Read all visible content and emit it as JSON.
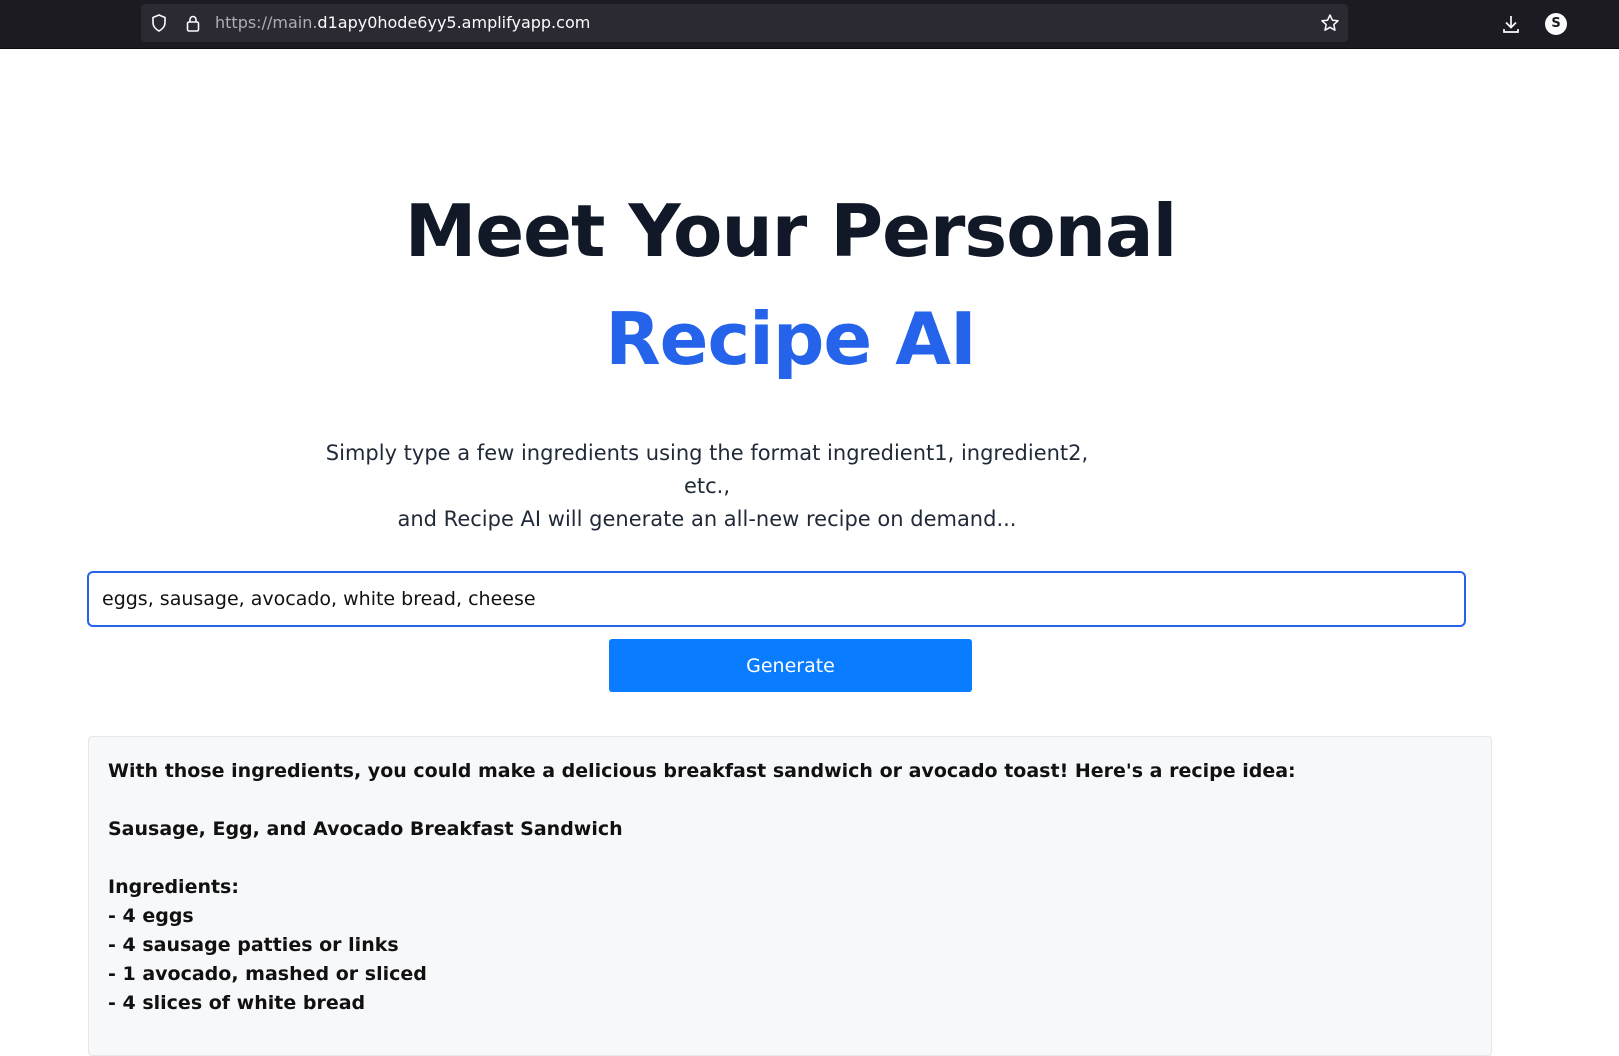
{
  "browser": {
    "url_scheme": "https://main.",
    "url_host": "d1apy0hode6yy5.amplifyapp.com",
    "profile_initial": "S"
  },
  "hero": {
    "line1": "Meet Your Personal",
    "line2": "Recipe AI",
    "accent_color": "#2563eb"
  },
  "subtitle": {
    "line1": "Simply type a few ingredients using the format ingredient1, ingredient2, etc.,",
    "line2": "and Recipe AI will generate an all-new recipe on demand..."
  },
  "input": {
    "value": "eggs, sausage, avocado, white bread, cheese"
  },
  "generate_button": {
    "label": "Generate",
    "color": "#0a7cff"
  },
  "result": {
    "intro": "With those ingredients, you could make a delicious breakfast sandwich or avocado toast! Here's a recipe idea:",
    "recipe_title": "Sausage, Egg, and Avocado Breakfast Sandwich",
    "ingredients_heading": "Ingredients:",
    "ingredients": [
      "- 4 eggs",
      "- 4 sausage patties or links",
      "- 1 avocado, mashed or sliced",
      "- 4 slices of white bread"
    ]
  }
}
